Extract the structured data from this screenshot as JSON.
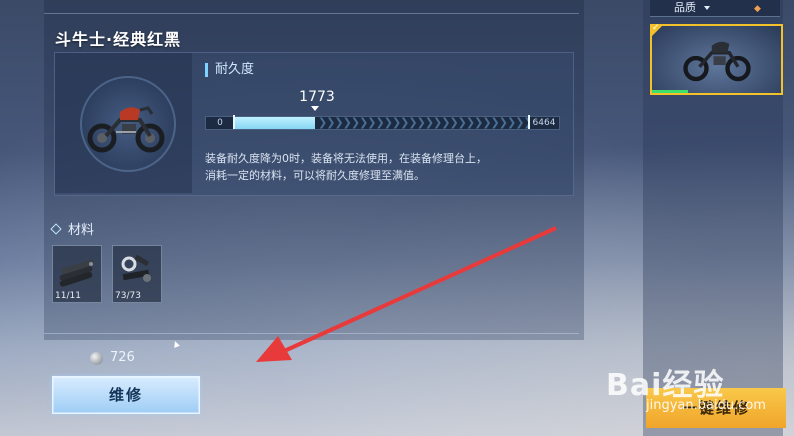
{
  "item": {
    "title": "斗牛士·经典红黑"
  },
  "durability": {
    "label": "耐久度",
    "current": "1773",
    "min": "0",
    "max": "6464",
    "fill_fraction": 0.274,
    "description_line1": "装备耐久度降为0时，装备将无法使用，在装备修理台上，",
    "description_line2": "消耗一定的材料，可以将耐久度修理至满值。"
  },
  "materials": {
    "label": "材料",
    "items": [
      {
        "icon": "steel-pipes-icon",
        "count": "11/11"
      },
      {
        "icon": "bolts-parts-icon",
        "count": "73/73"
      }
    ]
  },
  "cost": {
    "icon": "silver-coin-icon",
    "value": "726"
  },
  "repair_button": {
    "label": "维修"
  },
  "sidebar": {
    "quality_label": "品质",
    "quality_dropdown_icon": "triangle-down-icon",
    "sort_icon": "sort-arrows-icon",
    "selected_thumbnail": "motorcycle-icon"
  },
  "quick_repair": {
    "label": "一键维修"
  },
  "watermark": {
    "brand": "Bai经验",
    "url": "jingyan.baidu.com"
  },
  "colors": {
    "accent_blue": "#86d6f2",
    "selection_gold": "#f3c22a",
    "quick_repair_orange": "#f0a52a",
    "annotation_red": "#e83a3a"
  }
}
